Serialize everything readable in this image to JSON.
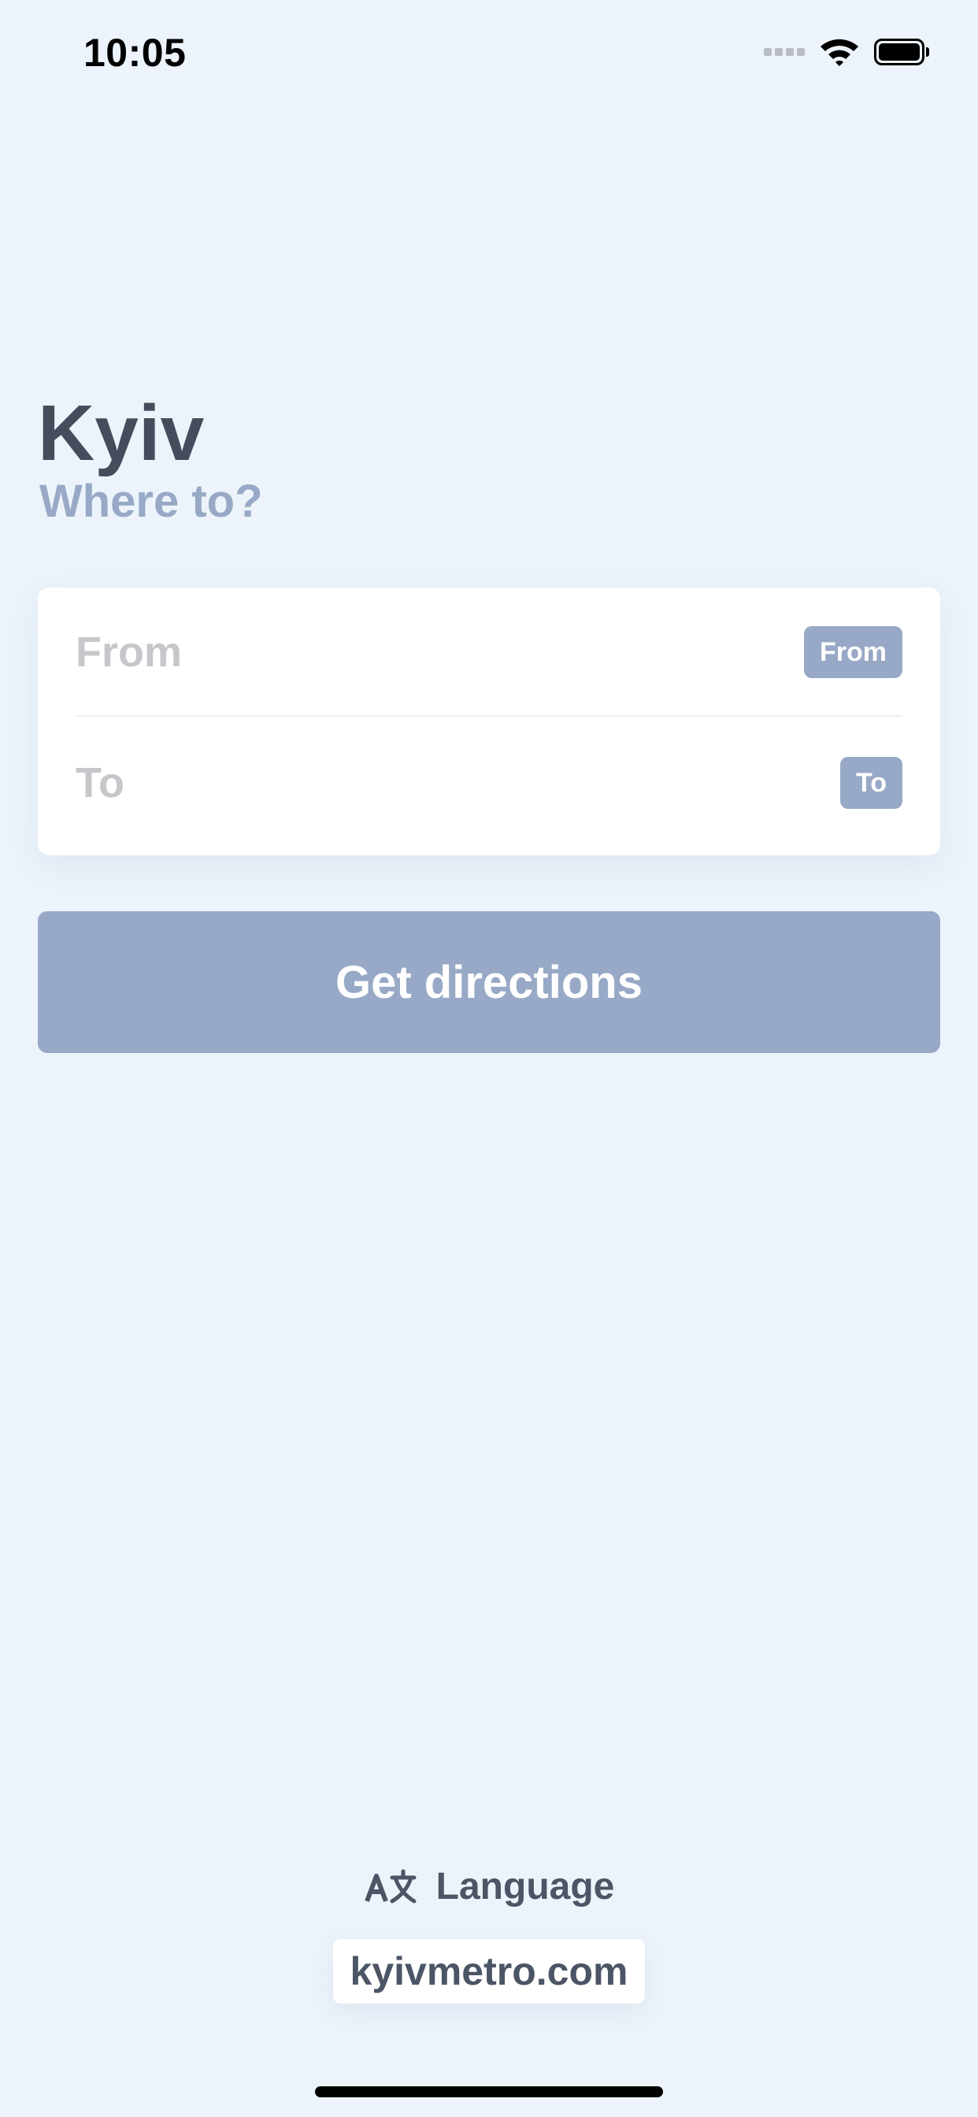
{
  "status_bar": {
    "time": "10:05",
    "icons": [
      "cellular-signal-icon",
      "wifi-icon",
      "battery-icon"
    ]
  },
  "header": {
    "title": "Kyiv",
    "subtitle": "Where to?"
  },
  "route_form": {
    "from": {
      "placeholder": "From",
      "chip_label": "From"
    },
    "to": {
      "placeholder": "To",
      "chip_label": "To"
    }
  },
  "actions": {
    "get_directions_label": "Get directions"
  },
  "footer": {
    "language_icon": "translate-icon",
    "language_label": "Language",
    "website_label": "kyivmetro.com"
  },
  "colors": {
    "background": "#ecf3fa",
    "accent": "#97a9c6",
    "title": "#454d5c",
    "placeholder": "#c6c7ca"
  }
}
